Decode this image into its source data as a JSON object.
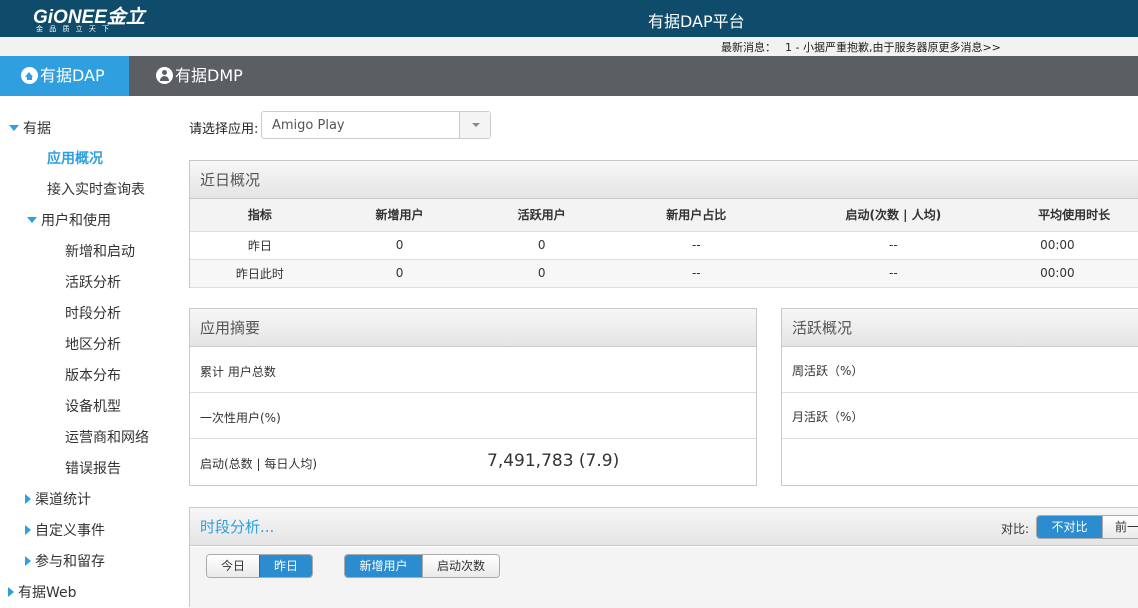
{
  "header": {
    "logo": "GiONEE金立",
    "logo_sub": "金 品 质    立 天 下",
    "title": "有据DAP平台"
  },
  "news": {
    "label": "最新消息：",
    "text": "1 - 小据严重抱歉,由于服务器原更多消息>>"
  },
  "nav": {
    "tabs": [
      {
        "label": "有据DAP",
        "icon": "home-icon"
      },
      {
        "label": "有据DMP",
        "icon": "user-icon"
      }
    ]
  },
  "sidebar": {
    "items": [
      {
        "label": "有据",
        "icon": "expanded-icon"
      },
      {
        "label": "应用概况"
      },
      {
        "label": "接入实时查询表"
      },
      {
        "label": "用户和使用",
        "icon": "expanded-icon"
      },
      {
        "label": "新增和启动"
      },
      {
        "label": "活跃分析"
      },
      {
        "label": "时段分析"
      },
      {
        "label": "地区分析"
      },
      {
        "label": "版本分布"
      },
      {
        "label": "设备机型"
      },
      {
        "label": "运营商和网络"
      },
      {
        "label": "错误报告"
      },
      {
        "label": "渠道统计",
        "icon": "collapsed-icon"
      },
      {
        "label": "自定义事件",
        "icon": "collapsed-icon"
      },
      {
        "label": "参与和留存",
        "icon": "collapsed-icon"
      },
      {
        "label": "有据Web",
        "icon": "collapsed-icon"
      }
    ]
  },
  "app_select": {
    "label": "请选择应用:",
    "value": "Amigo Play"
  },
  "recent": {
    "title": "近日概况",
    "headers": [
      "指标",
      "新增用户",
      "活跃用户",
      "新用户占比",
      "启动(次数 | 人均)",
      "平均使用时长"
    ],
    "rows": [
      [
        "昨日",
        "0",
        "0",
        "--",
        "--",
        "00:00"
      ],
      [
        "昨日此时",
        "0",
        "0",
        "--",
        "--",
        "00:00"
      ]
    ]
  },
  "summary": {
    "title": "应用摘要",
    "rows": [
      {
        "label": "累计 用户总数",
        "value": ""
      },
      {
        "label": "一次性用户(%)",
        "value": ""
      },
      {
        "label": "启动(总数 | 每日人均)",
        "value": "7,491,783 (7.9)"
      }
    ]
  },
  "active": {
    "title": "活跃概况",
    "rows": [
      {
        "label": "周活跃（%）"
      },
      {
        "label": "月活跃（%）"
      },
      {
        "label": ""
      }
    ]
  },
  "period": {
    "title": "时段分析...",
    "compare_label": "对比:",
    "compare_options": [
      "不对比",
      "前一"
    ],
    "day_options": [
      "今日",
      "昨日"
    ],
    "metric_options": [
      "新增用户",
      "启动次数"
    ]
  }
}
